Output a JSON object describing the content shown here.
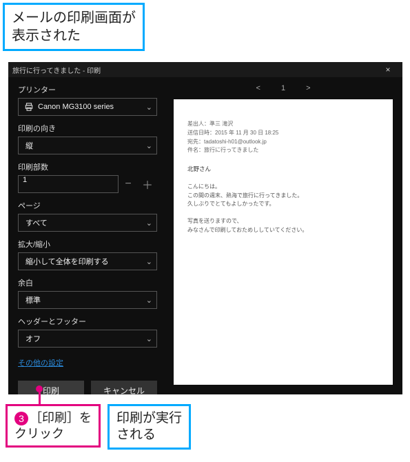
{
  "callouts": {
    "top_line1": "メールの印刷画面が",
    "top_line2": "表示された",
    "step_num": "3",
    "step_text1": "［印刷］を",
    "step_text2": "クリック",
    "result_line1": "印刷が実行",
    "result_line2": "される"
  },
  "dialog": {
    "title": "旅行に行ってきました - 印刷",
    "close_glyph": "×",
    "labels": {
      "printer": "プリンター",
      "orientation": "印刷の向き",
      "copies": "印刷部数",
      "pages": "ページ",
      "scale": "拡大/縮小",
      "margin": "余白",
      "headerfooter": "ヘッダーとフッター"
    },
    "values": {
      "printer": "Canon MG3100 series",
      "orientation": "縦",
      "copies": "1",
      "pages": "すべて",
      "scale": "縮小して全体を印刷する",
      "margin": "標準",
      "headerfooter": "オフ"
    },
    "more_settings": "その他の設定",
    "buttons": {
      "print": "印刷",
      "cancel": "キャンセル"
    },
    "nav": {
      "prev": "<",
      "page": "1",
      "next": ">"
    }
  },
  "preview": {
    "meta_from": "差出人：準三 滝沢",
    "meta_date": "送信日時：2015 年 11 月 30 日 18:25",
    "meta_to": "宛先：tadatoshi-h01@outlook.jp",
    "meta_subject": "件名：旅行に行ってきました",
    "greeting": "北野さん",
    "body1": "こんにちは。",
    "body2": "この間の週末、熱海で旅行に行ってきました。",
    "body3": "久しぶりでとてもよしかったです。",
    "body4": "写真を送りますので、",
    "body5": "みなさんで印刷しておためししていてください。"
  }
}
